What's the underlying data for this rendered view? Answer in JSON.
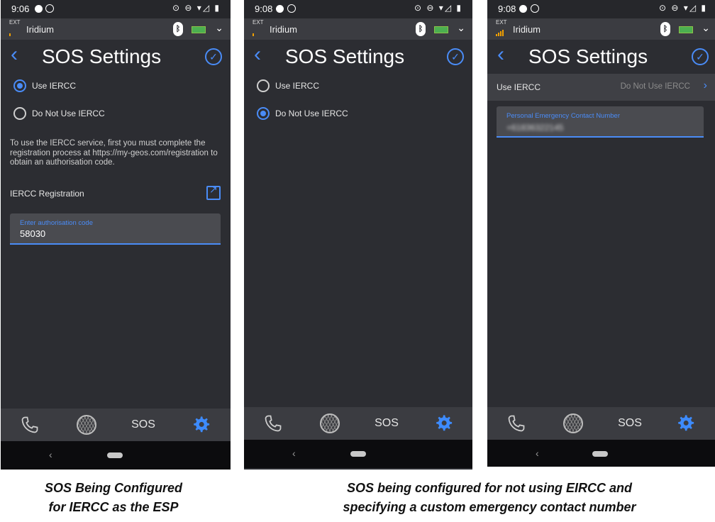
{
  "screens": [
    {
      "time": "9:06",
      "ext": "EXT",
      "carrier": "Iridium",
      "title": "SOS Settings",
      "options": [
        {
          "label": "Use IERCC",
          "selected": true
        },
        {
          "label": "Do Not Use IERCC",
          "selected": false
        }
      ],
      "info_text": "To use the IERCC service, first you must complete the registration process at https://my-geos.com/registration to obtain an authorisation code.",
      "registration_label": "IERCC Registration",
      "auth_field": {
        "label": "Enter authorisation code",
        "value": "58030"
      },
      "nav": {
        "sos": "SOS"
      }
    },
    {
      "time": "9:08",
      "ext": "EXT",
      "carrier": "Iridium",
      "title": "SOS Settings",
      "options": [
        {
          "label": "Use IERCC",
          "selected": false
        },
        {
          "label": "Do Not Use IERCC",
          "selected": true
        }
      ],
      "nav": {
        "sos": "SOS"
      }
    },
    {
      "time": "9:08",
      "ext": "EXT",
      "carrier": "Iridium",
      "title": "SOS Settings",
      "setting_row": {
        "label": "Use IERCC",
        "value": "Do Not Use IERCC"
      },
      "contact_field": {
        "label": "Personal Emergency Contact Number",
        "value": "+61836322145"
      },
      "nav": {
        "sos": "SOS"
      }
    }
  ],
  "captions": {
    "left_line1": "SOS Being Configured",
    "left_line2": "for IERCC as the ESP",
    "right_line1": "SOS being configured for not using EIRCC and",
    "right_line2": "specifying a custom emergency contact number"
  },
  "colors": {
    "accent": "#4a8cf7",
    "background": "#2c2d32"
  }
}
